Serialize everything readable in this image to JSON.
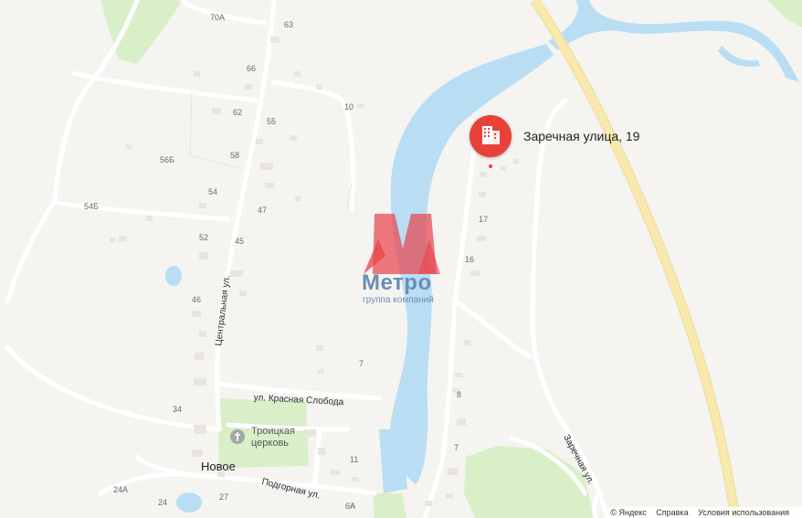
{
  "map": {
    "colors": {
      "water": "#b9def4",
      "road": "#ffffff",
      "highway": "#f9e5a3",
      "green": "#d8efc8",
      "pin": "#e8413a"
    },
    "house_numbers": [
      "70А",
      "63",
      "66",
      "62",
      "55",
      "58",
      "56Б",
      "54",
      "54Б",
      "47",
      "52",
      "45",
      "46",
      "10",
      "17",
      "16",
      "7",
      "8",
      "7",
      "34",
      "11",
      "24А",
      "24",
      "27",
      "6А"
    ],
    "streets": {
      "central": "Центральная ул.",
      "krasnaya": "ул. Красная Слобода",
      "podgornaya": "Подгорная ул.",
      "zarechnaya": "Заречная ул."
    },
    "place_name": "Новое",
    "poi": {
      "line1": "Троицкая",
      "line2": "церковь",
      "icon": "church-icon"
    },
    "selected": {
      "label": "Заречная улица, 19",
      "icon": "building-icon"
    },
    "watermark": {
      "title": "Метро",
      "subtitle": "группа компаний"
    },
    "footer": {
      "copyright": "© Яндекс",
      "help": "Справка",
      "terms": "Условия использования"
    }
  }
}
